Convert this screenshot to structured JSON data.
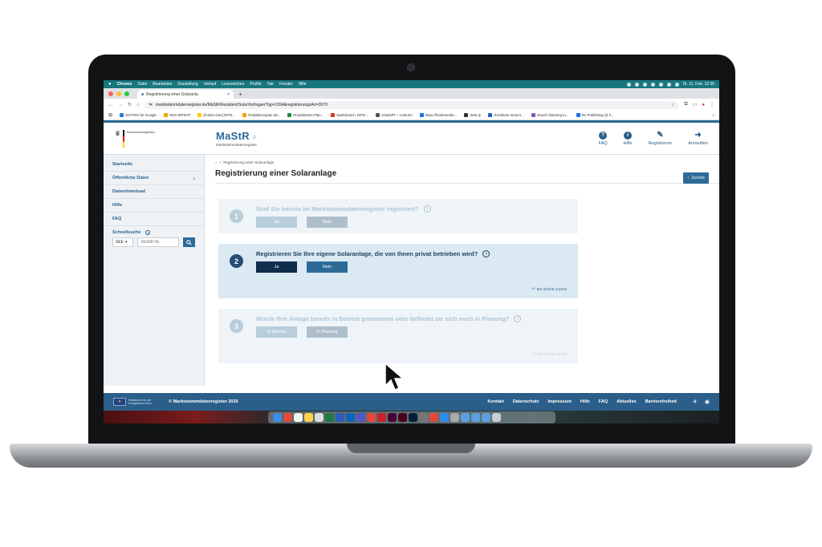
{
  "menubar": {
    "apple": "",
    "items": [
      "Chrome",
      "Datei",
      "Bearbeiten",
      "Darstellung",
      "Verlauf",
      "Lesezeichen",
      "Profile",
      "Tab",
      "Fenster",
      "Hilfe"
    ],
    "clock": "Di. 11. Feb. 12:35"
  },
  "browser": {
    "tab_title": "Registrierung einer Solaranla",
    "tab_close": "×",
    "new_tab": "+",
    "url": "marktstammdatenregister.de/MaStR/Assistent/SolarVorfragen?typ=1394&registrierungsArt=3070",
    "bookmarks": [
      "SISTRIX für Google",
      "SEO IMTEST",
      "[Funke-One] IMTE...",
      "Redaktionsplan IM...",
      "Produkttests Plan...",
      "Dashboard • IMTE...",
      "ChatGPT – Lektorin",
      "https://funkemedie...",
      "desk.ly",
      "checkliste-meta-ti...",
      "Search listening to...",
      "Re-Publishing @ F..."
    ],
    "bookmark_more": "»"
  },
  "site": {
    "agency": "Bundesnetzagentur",
    "logo": "MaStR",
    "logo_sub": "Marktstammdatenregister",
    "nav": {
      "faq": "FAQ",
      "hilfe": "Hilfe",
      "registrieren": "Registrieren",
      "anmelden": "Anmelden"
    }
  },
  "sidebar": {
    "items": [
      "Startseite",
      "Öffentliche Daten",
      "Datendownload",
      "Hilfe",
      "FAQ"
    ],
    "quick_search_label": "Schnellsuche",
    "select_value": "SEE",
    "input_placeholder": "MaStR-Nr."
  },
  "main": {
    "breadcrumb": "Registrierung einer Solaranlage",
    "title": "Registrierung einer Solaranlage",
    "back_label": "Zurück",
    "steps": [
      {
        "num": "1",
        "question": "Sind Sie bereits im Marktstammdatenregister registriert?",
        "btn1": "Ja",
        "btn2": "Nein",
        "back": ""
      },
      {
        "num": "2",
        "question": "Registrieren Sie Ihre eigene Solaranlage, die von Ihnen privat betrieben wird?",
        "btn1": "Ja",
        "btn2": "Nein",
        "back": "Ein Schritt zurück"
      },
      {
        "num": "3",
        "question": "Wurde Ihre Anlage bereits in Betrieb genommen oder befindet sie sich noch in Planung?",
        "btn1": "In Betrieb",
        "btn2": "In Planung",
        "back": "Ein Schritt zurück"
      }
    ]
  },
  "footer": {
    "eu_text": "Kofinanziert von der Europäischen Union",
    "copyright": "© Marktstammdatenregister 2025",
    "links": [
      "Kontakt",
      "Datenschutz",
      "Impressum",
      "Hilfe",
      "FAQ",
      "Aktuelles",
      "Barrierefreiheit"
    ]
  },
  "colors": {
    "primary": "#2e6a98",
    "dark_button": "#0f2e4c",
    "menubar": "#18767e"
  }
}
